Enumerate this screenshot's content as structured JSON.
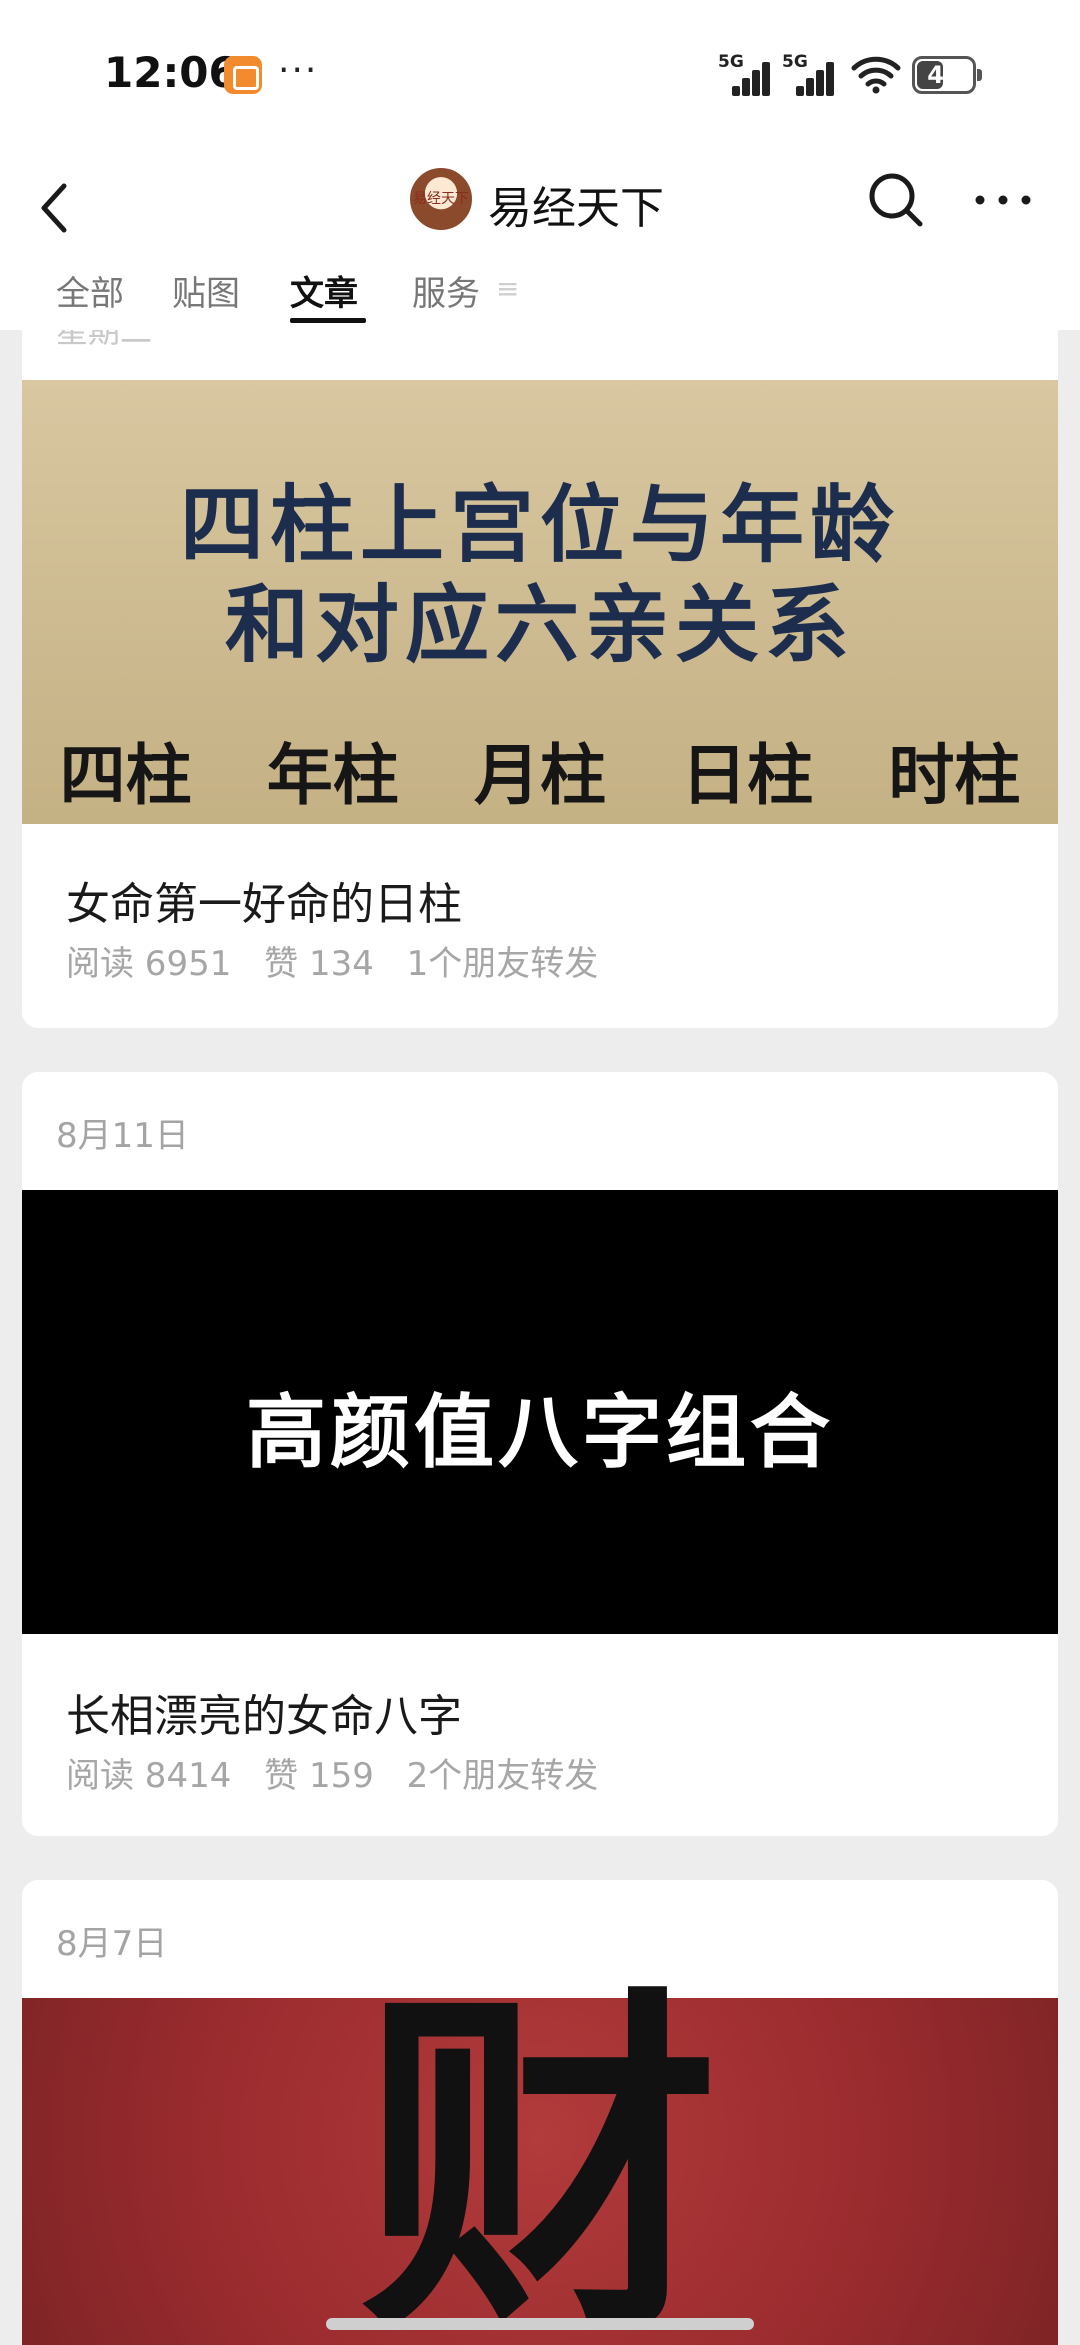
{
  "status_bar": {
    "time": "12:06",
    "more_dots": "···",
    "signal1_label": "5G",
    "signal2_label": "5G",
    "battery": "41"
  },
  "header": {
    "account_name": "易经天下",
    "avatar_text": "易经天下"
  },
  "tabs": [
    {
      "label": "全部"
    },
    {
      "label": "贴图"
    },
    {
      "label": "文章"
    },
    {
      "label": "服务"
    }
  ],
  "tab_overflow": "≡",
  "previous_date_partial": "星期二",
  "articles": [
    {
      "cover": {
        "line1": "四柱上宫位与年龄",
        "line2": "和对应六亲关系",
        "pillars": [
          "四柱",
          "年柱",
          "月柱",
          "日柱",
          "时柱"
        ]
      },
      "title": "女命第一好命的日柱",
      "reads": "阅读 6951",
      "likes": "赞 134",
      "shares": "1个朋友转发"
    },
    {
      "date": "8月11日",
      "cover": {
        "text": "高颜值八字组合"
      },
      "title": "长相漂亮的女命八字",
      "reads": "阅读 8414",
      "likes": "赞 159",
      "shares": "2个朋友转发"
    },
    {
      "date": "8月7日",
      "cover": {
        "glyph": "财"
      }
    }
  ],
  "colors": {
    "background": "#ededed",
    "card": "#ffffff",
    "meta": "#a6a6a6",
    "cover1_text": "#1c2d4d",
    "cover3_bg": "#9a2b2e"
  }
}
